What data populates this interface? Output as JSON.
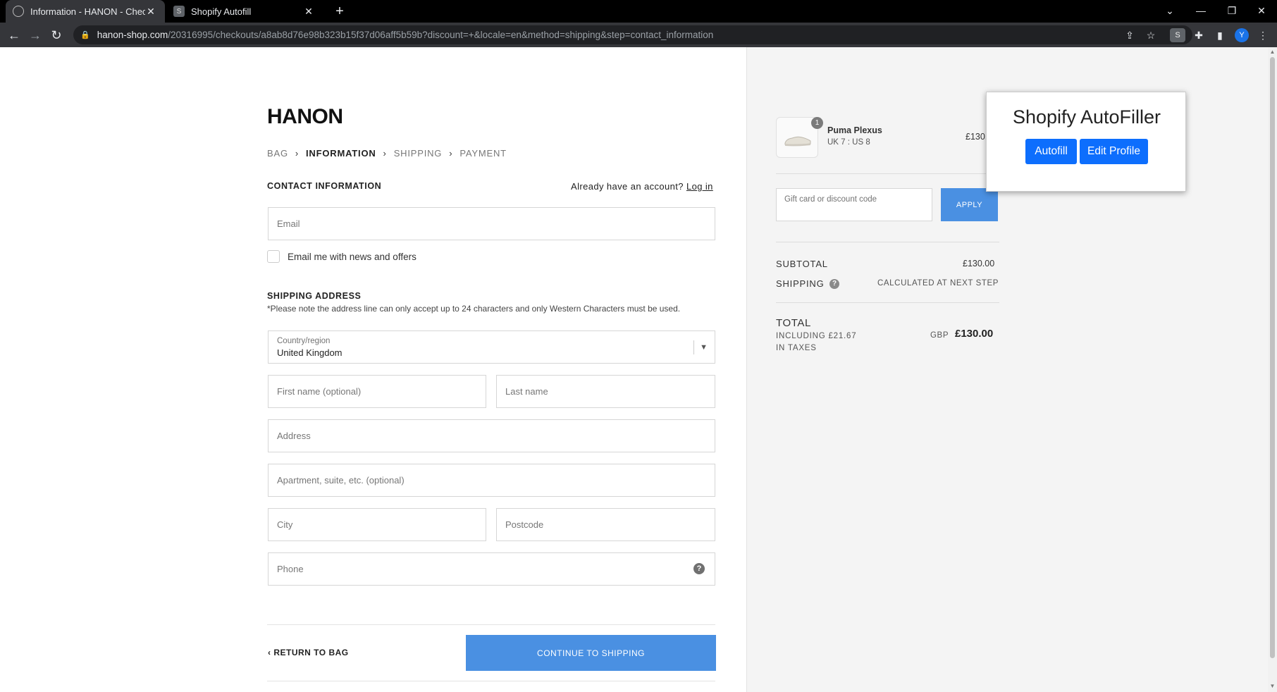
{
  "browser": {
    "tabs": [
      {
        "title": "Information - HANON - Checkou",
        "active": true
      },
      {
        "title": "Shopify Autofill",
        "active": false,
        "favicon": "S"
      }
    ],
    "url_host": "hanon-shop.com",
    "url_path": "/20316995/checkouts/a8ab8d76e98b323b15f37d06aff5b59b?discount=+&locale=en&method=shipping&step=contact_information",
    "extension_badge": "S",
    "profile_initial": "Y"
  },
  "store": {
    "logo": "HANON"
  },
  "breadcrumbs": [
    "BAG",
    "INFORMATION",
    "SHIPPING",
    "PAYMENT"
  ],
  "contact": {
    "heading": "CONTACT INFORMATION",
    "account_prompt": "Already have an account?",
    "login_link": "Log in",
    "email_placeholder": "Email",
    "newsletter_label": "Email me with news and offers"
  },
  "shipping_address": {
    "heading": "SHIPPING ADDRESS",
    "note": "*Please note the address line can only accept up to 24 characters and only Western Characters must be used.",
    "country_label": "Country/region",
    "country_value": "United Kingdom",
    "first_name_placeholder": "First name (optional)",
    "last_name_placeholder": "Last name",
    "address_placeholder": "Address",
    "apartment_placeholder": "Apartment, suite, etc. (optional)",
    "city_placeholder": "City",
    "postcode_placeholder": "Postcode",
    "phone_placeholder": "Phone"
  },
  "footer": {
    "return_label": "RETURN TO BAG",
    "continue_label": "CONTINUE TO SHIPPING"
  },
  "order_summary": {
    "product": {
      "name": "Puma Plexus",
      "variant": "UK 7 : US 8",
      "price": "£130.",
      "quantity": "1"
    },
    "discount_placeholder": "Gift card or discount code",
    "apply_label": "APPLY",
    "subtotal_label": "SUBTOTAL",
    "subtotal_value": "£130.00",
    "shipping_label": "SHIPPING",
    "shipping_value": "CALCULATED AT NEXT STEP",
    "total_label": "TOTAL",
    "tax_note": "INCLUDING £21.67 IN TAXES",
    "currency": "GBP",
    "total_value": "£130.00"
  },
  "autofill_popup": {
    "title": "Shopify AutoFiller",
    "autofill_label": "Autofill",
    "edit_profile_label": "Edit Profile"
  },
  "colors": {
    "accent": "#4a90e2",
    "popup_button": "#0d6efd"
  }
}
